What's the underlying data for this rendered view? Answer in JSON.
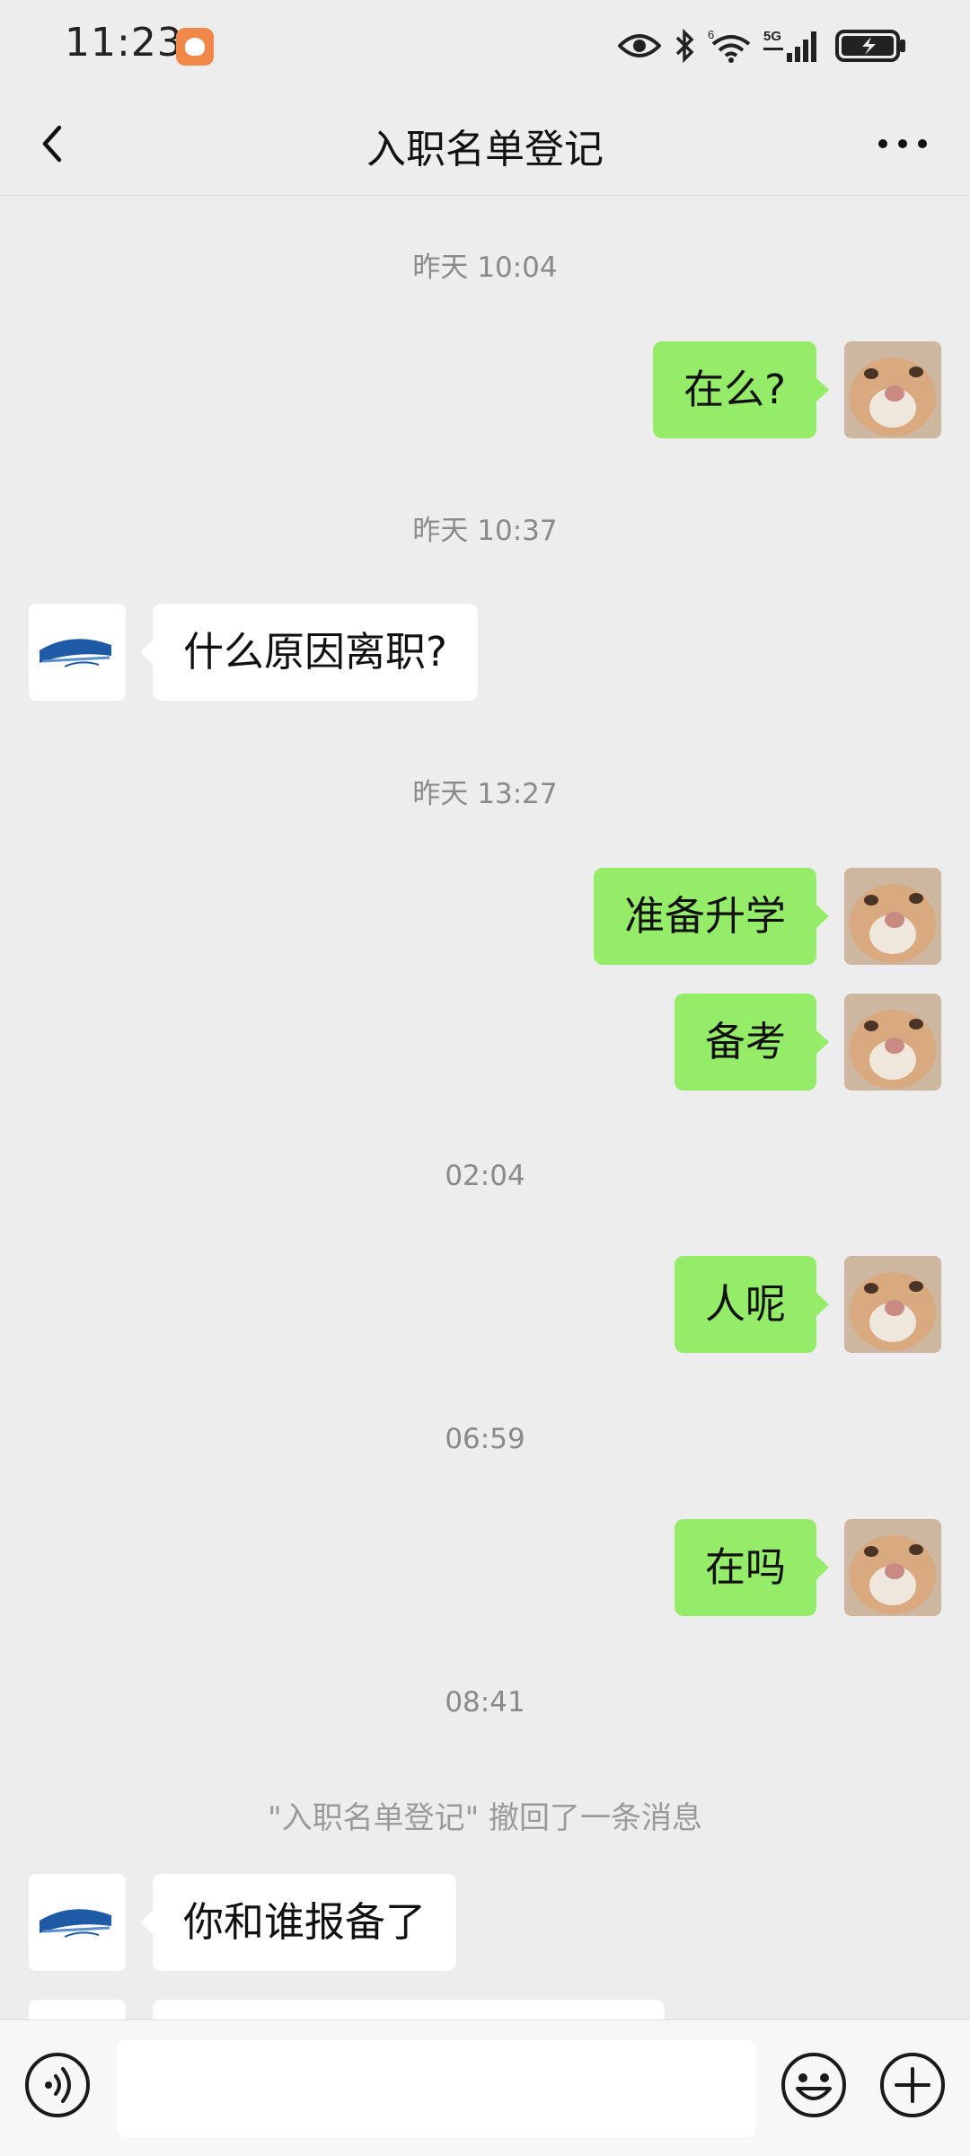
{
  "status_bar": {
    "time": "11:23",
    "network_label": "5G",
    "wifi_label": "6"
  },
  "header": {
    "title": "入职名单登记"
  },
  "messages": [
    {
      "type": "time",
      "text": "昨天 10:04"
    },
    {
      "type": "me",
      "text": "在么?"
    },
    {
      "type": "time",
      "text": "昨天 10:37"
    },
    {
      "type": "them",
      "text": "什么原因离职?"
    },
    {
      "type": "time",
      "text": "昨天 13:27"
    },
    {
      "type": "me",
      "text": "准备升学"
    },
    {
      "type": "me",
      "text": "备考"
    },
    {
      "type": "time",
      "text": "02:04"
    },
    {
      "type": "me",
      "text": "人呢"
    },
    {
      "type": "time",
      "text": "06:59"
    },
    {
      "type": "me",
      "text": "在吗"
    },
    {
      "type": "time",
      "text": "08:41"
    },
    {
      "type": "system",
      "text": "\"入职名单登记\" 撤回了一条消息"
    },
    {
      "type": "them",
      "text": "你和谁报备了"
    },
    {
      "type": "them",
      "text": ""
    }
  ],
  "input": {
    "value": "",
    "placeholder": ""
  },
  "colors": {
    "background": "#ededed",
    "my_bubble": "#95ec69",
    "their_bubble": "#ffffff",
    "timestamp": "#8a8a8a"
  }
}
